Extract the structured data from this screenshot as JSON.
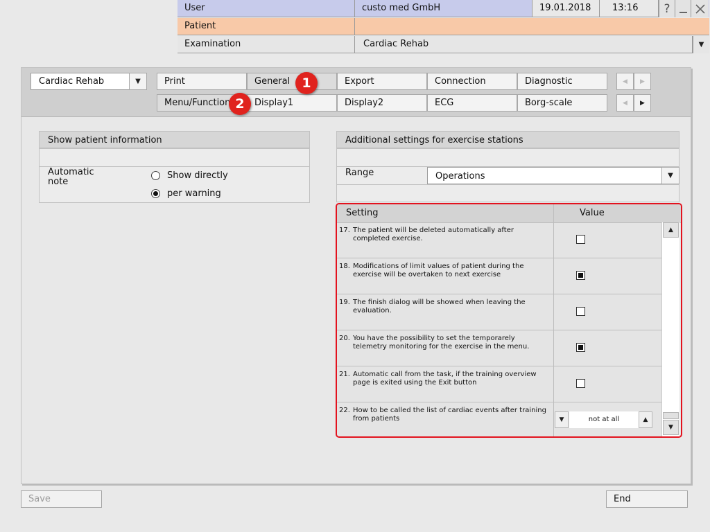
{
  "header": {
    "user_label": "User",
    "company": "custo med GmbH",
    "date": "19.01.2018",
    "time": "13:16",
    "patient_label": "Patient",
    "examination_label": "Examination",
    "examination_value": "Cardiac Rehab"
  },
  "module_select": {
    "value": "Cardiac Rehab"
  },
  "tabs_row1": [
    "Print",
    "General",
    "Export",
    "Connection",
    "Diagnostic"
  ],
  "tabs_row2": [
    "Menu/Functions",
    "Display1",
    "Display2",
    "ECG",
    "Borg-scale"
  ],
  "badges": [
    "1",
    "2"
  ],
  "left_section": {
    "title": "Show patient information",
    "automatic_note_line1": "Automatic",
    "automatic_note_line2": "note",
    "options": [
      "Show directly",
      "per warning"
    ],
    "selected_option": "per warning"
  },
  "right_section": {
    "title": "Additional settings for exercise stations",
    "range_label": "Range",
    "range_value": "Operations"
  },
  "settings_table": {
    "col_setting": "Setting",
    "col_value": "Value",
    "rows": [
      {
        "num": "17.",
        "text": "The patient will be deleted automatically after completed exercise.",
        "checked": false
      },
      {
        "num": "18.",
        "text": "Modifications of limit values of patient during the exercise will be overtaken to next exercise",
        "checked": true
      },
      {
        "num": "19.",
        "text": "The finish dialog will be showed when leaving the evaluation.",
        "checked": false
      },
      {
        "num": "20.",
        "text": "You have the possibility to set the temporarely telemetry monitoring for the exercise in the menu.",
        "checked": true
      },
      {
        "num": "21.",
        "text": "Automatic call from the task, if the training overview page is exited using the Exit button",
        "checked": false
      },
      {
        "num": "22.",
        "text": "How to be called the list of cardiac events after training from patients",
        "select_value": "not at all"
      }
    ]
  },
  "footer": {
    "save_label": "Save",
    "end_label": "End"
  }
}
